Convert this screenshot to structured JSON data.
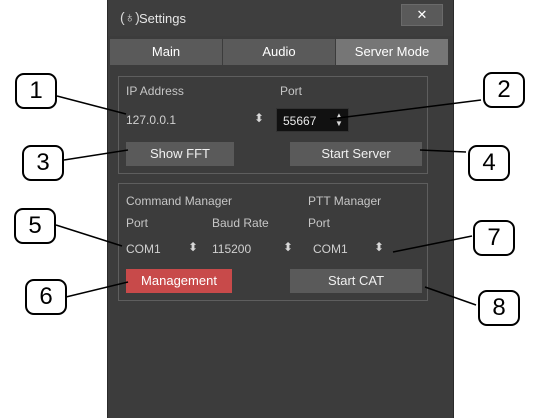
{
  "window": {
    "title": "Settings",
    "close_glyph": "✕"
  },
  "tabs": [
    {
      "label": "Main",
      "active": false
    },
    {
      "label": "Audio",
      "active": false
    },
    {
      "label": "Server Mode",
      "active": true
    }
  ],
  "server": {
    "ip_label": "IP Address",
    "ip_value": "127.0.0.1",
    "port_label": "Port",
    "port_value": "55667",
    "show_fft_label": "Show FFT",
    "start_server_label": "Start Server"
  },
  "cat": {
    "command_manager_label": "Command Manager",
    "ptt_manager_label": "PTT Manager",
    "cmd_port_label": "Port",
    "baud_rate_label": "Baud Rate",
    "ptt_port_label": "Port",
    "cmd_port_value": "COM1",
    "baud_rate_value": "115200",
    "ptt_port_value": "COM1",
    "management_label": "Management",
    "start_cat_label": "Start CAT"
  },
  "callouts": [
    "1",
    "2",
    "3",
    "4",
    "5",
    "6",
    "7",
    "8"
  ],
  "colors": {
    "window_bg": "#3c3c3c",
    "management_red": "#c84a4a",
    "tab_active": "#767676"
  }
}
